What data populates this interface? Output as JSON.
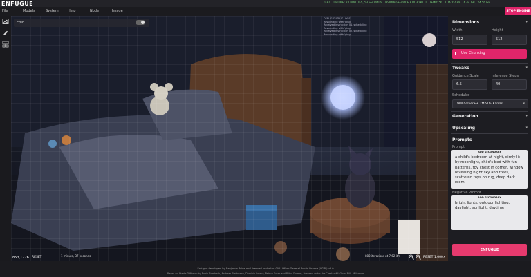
{
  "app": {
    "title": "ENFUGUE",
    "stop_label": "STOP ENGINE"
  },
  "status": {
    "version": "0.3.0",
    "uptime": "UPTIME: 24 MINUTES, 53 SECONDS",
    "gpu": "NVIDIA GEFORCE RTX 3090 TI",
    "temp": "TEMP: 56",
    "load": "LOAD: 43%",
    "vram": "6.44 GB / 24.56 GB"
  },
  "menu": [
    "File",
    "Models",
    "System",
    "Help",
    "Node",
    "Image"
  ],
  "tools": [
    "image-icon",
    "pencil-icon",
    "node-icon"
  ],
  "canvas": {
    "layer_name": "Epic",
    "log": [
      "DEBUG OUTPUT LOGS",
      "Responding with 'ping'",
      "Received instruction 01, scheduling",
      "Responding with 'ping'",
      "Received instruction 02, scheduling",
      "Responding with 'ping'"
    ],
    "coords": "853,1226",
    "reset": "RESET",
    "time_info": "1 minute, 37 seconds",
    "iter_info": "882 iterations at 7.62 it/s",
    "zoom_reset": "RESET",
    "zoom": "1.000×"
  },
  "panel": {
    "dimensions": {
      "title": "Dimensions",
      "width_label": "Width",
      "width": "512",
      "height_label": "Height",
      "height": "512",
      "chunking": "Use Chunking"
    },
    "tweaks": {
      "title": "Tweaks",
      "guidance_label": "Guidance Scale",
      "guidance": "6.5",
      "steps_label": "Inference Steps",
      "steps": "40",
      "scheduler_label": "Scheduler",
      "scheduler": "DPM-Solver++ 2M SDE Karras"
    },
    "generation_title": "Generation",
    "upscaling_title": "Upscaling",
    "prompts": {
      "title": "Prompts",
      "prompt_label": "Prompt",
      "add_secondary": "ADD SECONDARY",
      "prompt": "a child's bedroom at night, dimly lit by moonlight, child's bed with fun patterns, toy chest in corner, window revealing night sky and trees, scattered toys on rug, deep dark room",
      "negative_label": "Negative Prompt",
      "negative_add": "ADD SECONDARY",
      "negative": "bright lights, outdoor lighting, daylight, sunlight, daytime"
    },
    "enfugue_button": "ENFUGUE"
  },
  "footer": {
    "line1": "Enfugue developed by Benjamin Paine and licensed under the GNU Affero General Public License (AGPL) v3.0",
    "line2": "Based on Stable Diffusion by Robin Rombach, Andreas Blattmann, Dominik Lorenz, Patrick Esser and Björn Ommer, licensed under the CreativeML Open RAIL-M license"
  },
  "colors": {
    "accent": "#e0256a",
    "status_text": "#7fd37f"
  }
}
